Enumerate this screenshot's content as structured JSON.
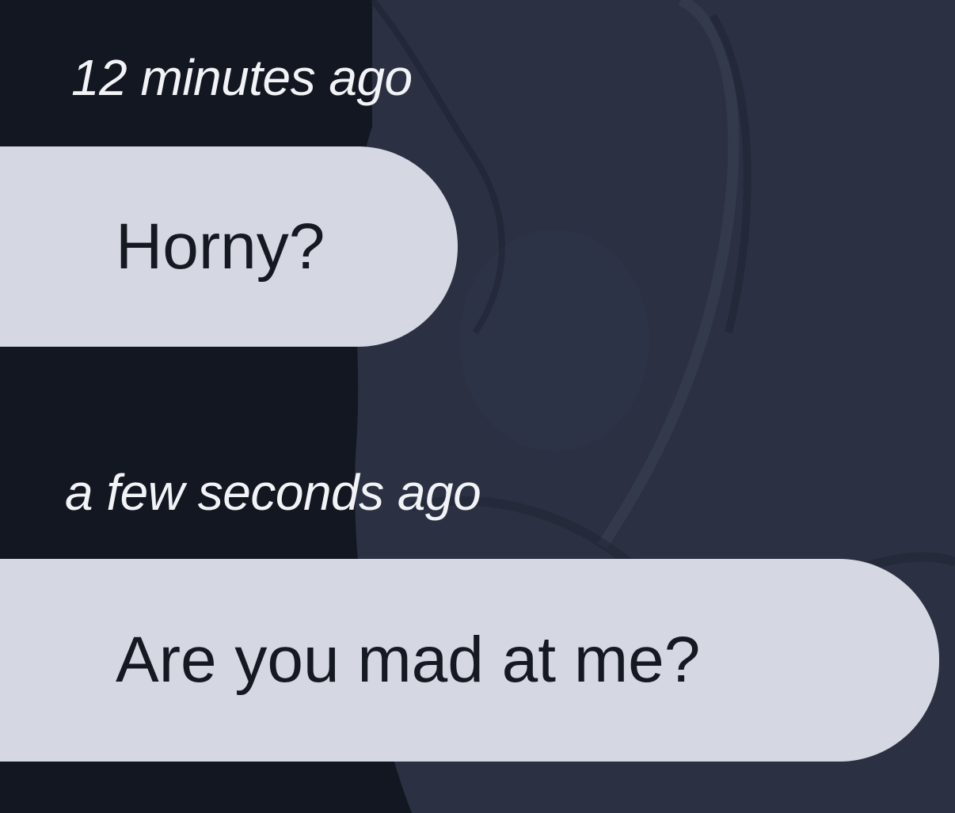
{
  "messages": [
    {
      "timestamp": "12 minutes ago",
      "text": "Horny?"
    },
    {
      "timestamp": "a few seconds ago",
      "text": "Are you mad at me?"
    }
  ],
  "colors": {
    "background_dark": "#131722",
    "background_wallpaper": "#2b3142",
    "bubble": "#d5d8e2",
    "bubble_text": "#151922",
    "timestamp_text": "#f2f3f6"
  }
}
